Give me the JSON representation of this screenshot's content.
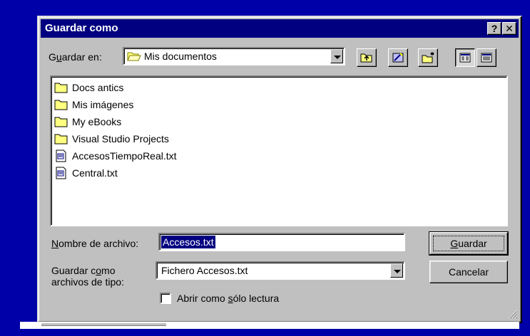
{
  "dialog": {
    "title": "Guardar como",
    "help_glyph": "?",
    "close_glyph": "✕"
  },
  "save_in": {
    "label_prefix": "G",
    "label_accel": "u",
    "label_suffix": "ardar en:",
    "value": "Mis documentos",
    "icon": "open-folder-icon"
  },
  "toolbar": [
    {
      "name": "up-one-level",
      "icon": "folder-up-icon"
    },
    {
      "name": "search-web",
      "icon": "favorites-icon"
    },
    {
      "name": "new-folder",
      "icon": "new-folder-icon"
    },
    {
      "name": "list-view",
      "icon": "list-view-icon",
      "pressed": true
    },
    {
      "name": "details-view",
      "icon": "details-view-icon"
    }
  ],
  "files": [
    {
      "name": "Docs antics",
      "type": "folder"
    },
    {
      "name": "Mis imágenes",
      "type": "folder"
    },
    {
      "name": "My eBooks",
      "type": "folder"
    },
    {
      "name": "Visual Studio Projects",
      "type": "folder"
    },
    {
      "name": "AccesosTiempoReal.txt",
      "type": "text-file"
    },
    {
      "name": "Central.txt",
      "type": "text-file"
    }
  ],
  "filename": {
    "label_accel": "N",
    "label_rest": "ombre de archivo:",
    "value": "Accesos.txt"
  },
  "filetype": {
    "label_line1_pre": "Guardar c",
    "label_line1_accel": "o",
    "label_line1_post": "mo",
    "label_line2": "archivos de tipo:",
    "value": "Fichero Accesos.txt"
  },
  "readonly": {
    "label_pre": "Abrir como ",
    "label_accel": "s",
    "label_post": "ólo lectura",
    "checked": false
  },
  "buttons": {
    "save_accel": "G",
    "save_rest": "uardar",
    "cancel": "Cancelar"
  },
  "colors": {
    "desktop": "#0000a8",
    "titlebar": "#000080",
    "face": "#c0c0c0",
    "selection": "#000080",
    "folder": "#ffff80"
  }
}
